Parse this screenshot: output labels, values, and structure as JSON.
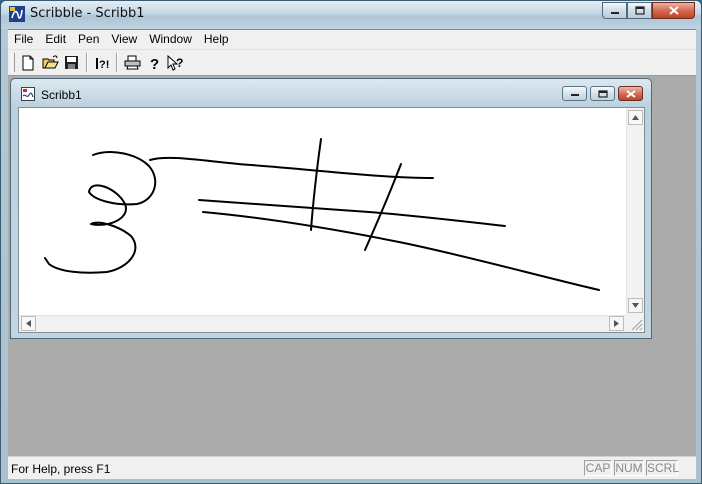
{
  "window": {
    "title": "Scribble - Scribb1"
  },
  "menu": {
    "items": [
      "File",
      "Edit",
      "Pen",
      "View",
      "Window",
      "Help"
    ]
  },
  "toolbar": {
    "buttons": [
      {
        "icon": "new-document-icon"
      },
      {
        "icon": "open-folder-icon"
      },
      {
        "icon": "save-disk-icon"
      },
      {
        "icon": "about-icon"
      },
      {
        "icon": "print-icon"
      },
      {
        "icon": "help-icon"
      },
      {
        "icon": "context-help-icon"
      }
    ]
  },
  "child": {
    "title": "Scribb1"
  },
  "status": {
    "text": "For Help, press F1",
    "indicators": [
      "CAP",
      "NUM",
      "SCRL"
    ]
  },
  "colors": {
    "ink": "#000000",
    "mdi_background": "#ababab",
    "close_button": "#c0432a"
  }
}
